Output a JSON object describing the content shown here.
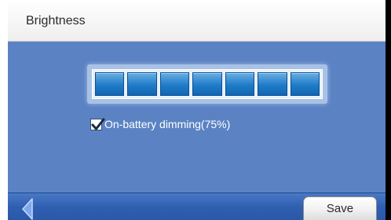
{
  "header": {
    "title": "Brightness"
  },
  "brightness": {
    "level": 7,
    "max_level": 7
  },
  "dimming": {
    "label": "On-battery dimming(75%)",
    "checked": true
  },
  "footer": {
    "back_icon": "back-arrow-icon",
    "save_label": "Save"
  },
  "colors": {
    "content_bg": "#5b83c4",
    "segment": "#1f7cc8",
    "footer_bg": "#2f5fb0",
    "back_arrow": "#7fa8ec"
  }
}
